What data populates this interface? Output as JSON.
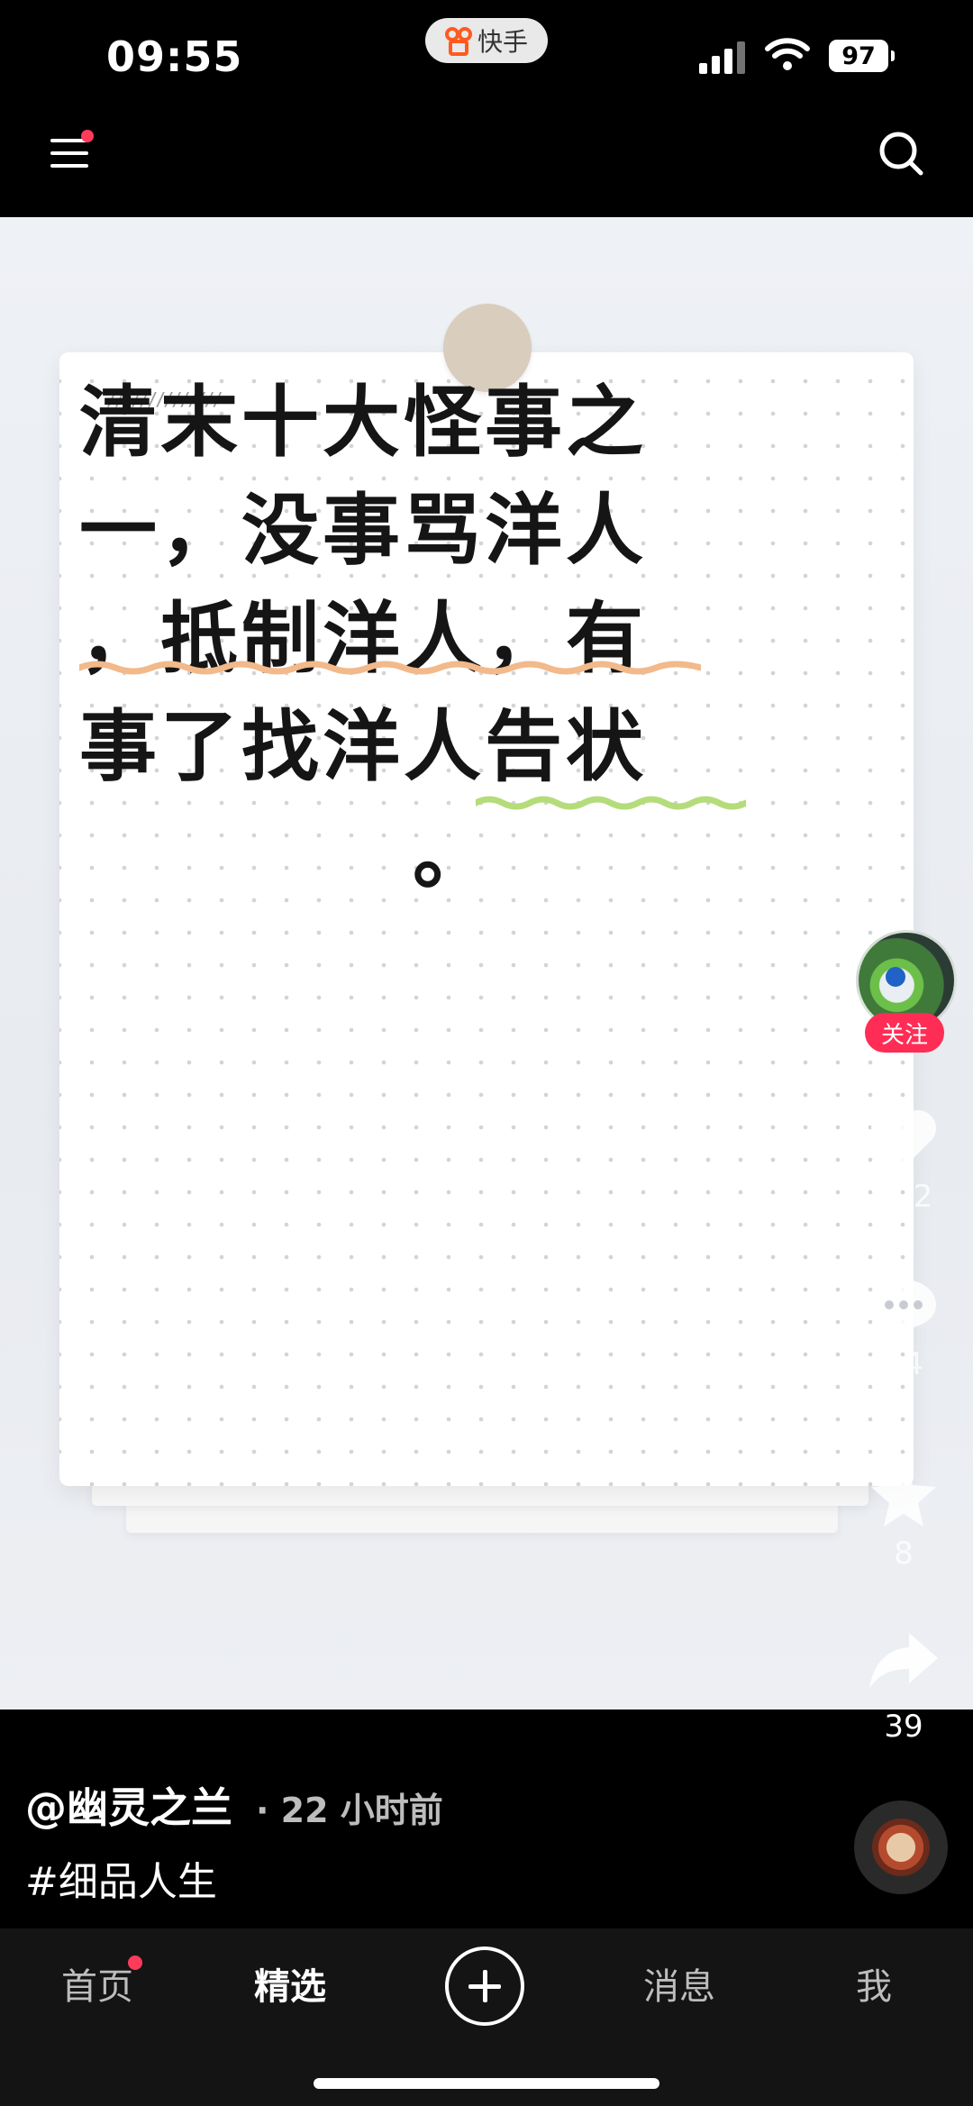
{
  "status_bar": {
    "time": "09:55",
    "app_name": "快手",
    "battery": "97"
  },
  "post": {
    "image_text_lines": [
      "清末十大怪事之",
      "一，没事骂洋人",
      "，抵制洋人，有",
      "事了找洋人告状",
      "。"
    ],
    "author": "@幽灵之兰",
    "time_ago": "· 22 小时前",
    "hashtag": "#细品人生"
  },
  "rail": {
    "follow_label": "关注",
    "likes": "502",
    "comments": "24",
    "favorites": "8",
    "shares": "39"
  },
  "tabs": {
    "home": "首页",
    "featured": "精选",
    "messages": "消息",
    "me": "我"
  },
  "colors": {
    "accent": "#ff2d55",
    "underline_orange": "#f2b98a",
    "underline_green": "#b5dc7a"
  },
  "icons": [
    "menu-icon",
    "search-icon",
    "heart-icon",
    "comment-icon",
    "star-icon",
    "share-icon",
    "plus-icon"
  ]
}
